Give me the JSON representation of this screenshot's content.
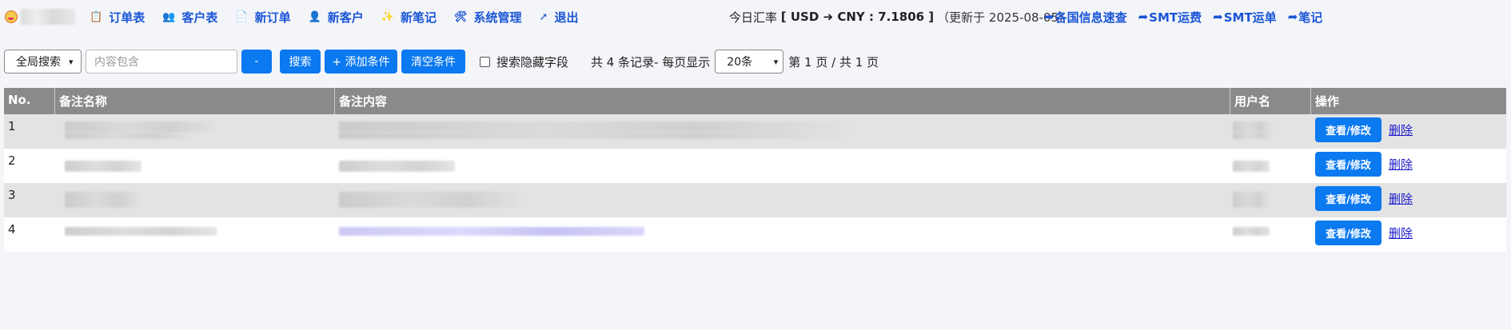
{
  "nav": {
    "items": [
      {
        "label": "订单表",
        "icon": "clipboard-icon",
        "glyph": "📋"
      },
      {
        "label": "客户表",
        "icon": "users-icon",
        "glyph": "👥"
      },
      {
        "label": "新订单",
        "icon": "document-icon",
        "glyph": "📄"
      },
      {
        "label": "新客户",
        "icon": "person-add-icon",
        "glyph": "👤"
      },
      {
        "label": "新笔记",
        "icon": "sparkle-icon",
        "glyph": "✨"
      },
      {
        "label": "系统管理",
        "icon": "tools-icon",
        "glyph": "🛠"
      },
      {
        "label": "退出",
        "icon": "logout-icon",
        "glyph": "➚"
      }
    ],
    "rate": {
      "prefix": "今日汇率",
      "pair": "[ USD ➜ CNY : 7.1806 ]",
      "updated": "（更新于 2025-08-05）"
    },
    "links": [
      "各国信息速查",
      "SMT运费",
      "SMT运单",
      "笔记"
    ],
    "link_arrow": "➦"
  },
  "toolbar": {
    "scope_select": "全局搜索",
    "search_placeholder": "内容包含",
    "minus_label": "-",
    "search_label": "搜索",
    "add_condition_label": "+ 添加条件",
    "clear_label": "清空条件",
    "hidden_fields_label": "搜索隐藏字段",
    "record_info": "共 4 条记录- 每页显示",
    "page_size": "20条",
    "page_info": "第 1 页 / 共 1 页"
  },
  "table": {
    "headers": [
      "No.",
      "备注名称",
      "备注内容",
      "用户名",
      "操作"
    ],
    "rows": [
      {
        "no": "1"
      },
      {
        "no": "2"
      },
      {
        "no": "3"
      },
      {
        "no": "4"
      }
    ],
    "view_label": "查看/修改",
    "delete_label": "删除"
  },
  "colors": {
    "accent": "#0b79f0",
    "link": "#1a55d6",
    "header_bg": "#8a8a8a"
  }
}
